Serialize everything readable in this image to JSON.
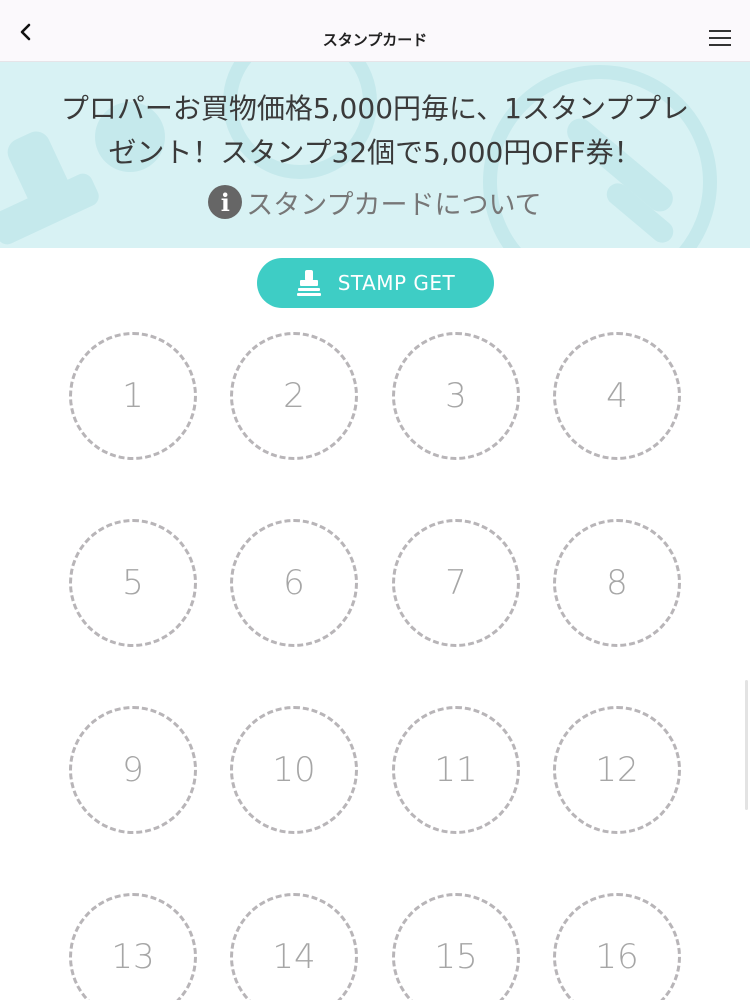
{
  "header": {
    "title": "スタンプカード",
    "back_icon": "chevron-left-icon",
    "menu_icon": "hamburger-menu-icon"
  },
  "banner": {
    "line1": "プロパーお買物価格5,000円毎に、1スタンププレ",
    "line2": "ゼント！スタンプ32個で5,000円OFF券！",
    "info_icon_glyph": "i",
    "info_label": "スタンプカードについて",
    "background_color": "#d8f2f4"
  },
  "stamp_get": {
    "label": "STAMP GET",
    "icon": "stamp-icon",
    "color": "#3ecdc5"
  },
  "stamps": [
    "1",
    "2",
    "3",
    "4",
    "5",
    "6",
    "7",
    "8",
    "9",
    "10",
    "11",
    "12",
    "13",
    "14",
    "15",
    "16"
  ]
}
